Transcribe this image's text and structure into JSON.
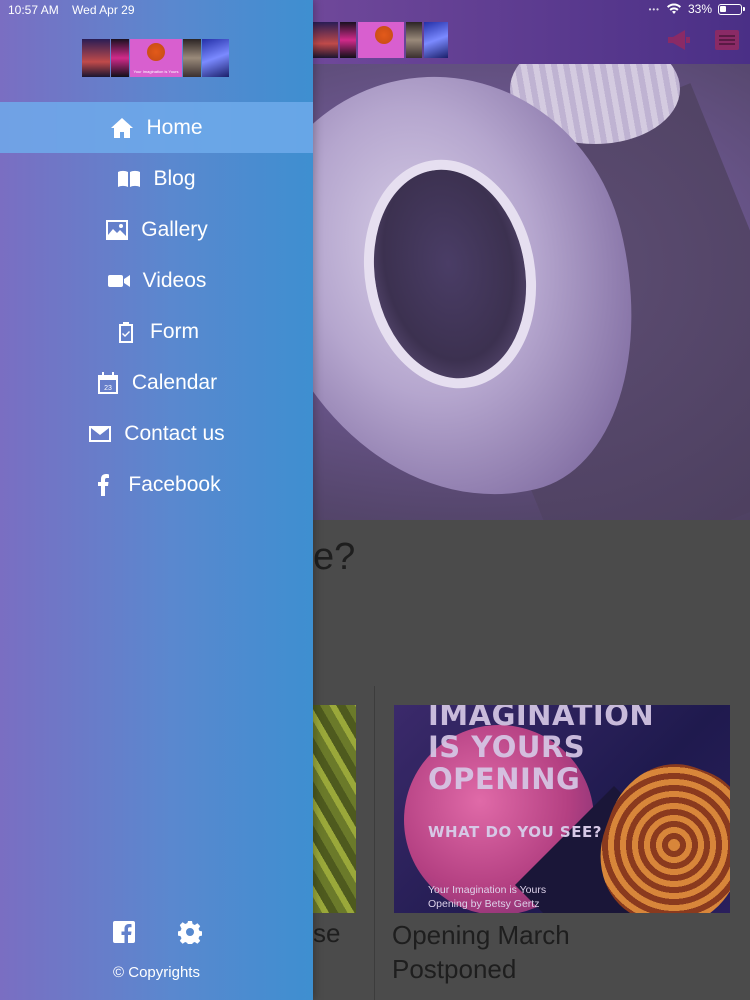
{
  "status_bar": {
    "time": "10:57 AM",
    "date": "Wed Apr 29",
    "battery": "33%"
  },
  "drawer": {
    "logo_caption": "Your Imagination is Yours",
    "menu": [
      {
        "label": "Home",
        "icon": "home-icon",
        "active": true
      },
      {
        "label": "Blog",
        "icon": "book-icon"
      },
      {
        "label": "Gallery",
        "icon": "image-icon"
      },
      {
        "label": "Videos",
        "icon": "video-camera-icon"
      },
      {
        "label": "Form",
        "icon": "clipboard-icon"
      },
      {
        "label": "Calendar",
        "icon": "calendar-icon"
      },
      {
        "label": "Contact us",
        "icon": "envelope-icon"
      },
      {
        "label": "Facebook",
        "icon": "facebook-icon"
      }
    ],
    "footer": {
      "icons": [
        "facebook-square-icon",
        "gear-icon"
      ],
      "copyright": "© Copyrights"
    }
  },
  "page": {
    "partial_heading": "e?",
    "cards": [
      {
        "title": "se"
      },
      {
        "title": "Opening March\nPostponed",
        "image_headline": "IMAGINATION\nIS YOURS\nOPENING",
        "image_question": "WHAT DO YOU SEE?",
        "image_caption": "Your Imagination is Yours\nOpening by Betsy Gertz"
      }
    ]
  },
  "colors": {
    "drawer_left": "#7a6ec2",
    "drawer_right": "#3e8fd0",
    "active_item": "#6eaaeb",
    "header_left": "#8a5aa8",
    "header_right": "#4a2f86"
  }
}
